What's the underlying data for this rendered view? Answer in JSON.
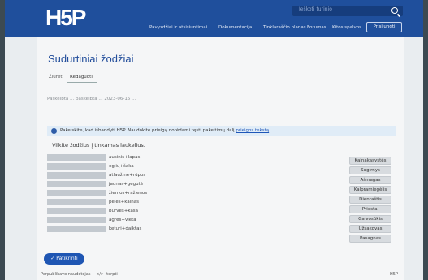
{
  "header": {
    "logo": "H5P",
    "search_placeholder": "Ieškoti turinio",
    "nav": [
      "Pavyzdžiai ir atsisiuntimai",
      "Dokumentacija",
      "Tinklaraščio planas",
      "Forumas",
      "Kitos spalvos",
      "Prisijungti"
    ]
  },
  "page": {
    "title": "Sudurtiniai žodžiai",
    "tabs": [
      "Žiūrėti",
      "Redaguoti"
    ],
    "meta": "Paskelbta ... paskelbta ... 2023-06-15 ..."
  },
  "info_bar": {
    "text": "Pakeiskite, kad išbandyti H5P. Naudokite prieigą norėdami tęsti pakeitimų dalį",
    "link": "prieigos tekstą"
  },
  "task": {
    "title": "Vilkite žodžius į tinkamas laukelius.",
    "words": [
      "ausinis+lapas",
      "eglių+šaka",
      "atlaužinė+rūpos",
      "jaunas+gegutė",
      "žiemos+ražienos",
      "pelės+kalnas",
      "burves+kasa",
      "agrės+vieta",
      "keturi+daiktas"
    ],
    "answers": [
      "Kalnakasystės",
      "Sugirnys",
      "Ašmagas",
      "Kalpramiegėlis",
      "Dienraštis",
      "Priestai",
      "Galvosūkis",
      "Užsakovas",
      "Pasagnas"
    ],
    "check_label": "Patikrinti"
  },
  "footer": {
    "items": [
      "Perpublikavo naudotojas",
      "</> Įterpti"
    ],
    "right": "H5P"
  }
}
